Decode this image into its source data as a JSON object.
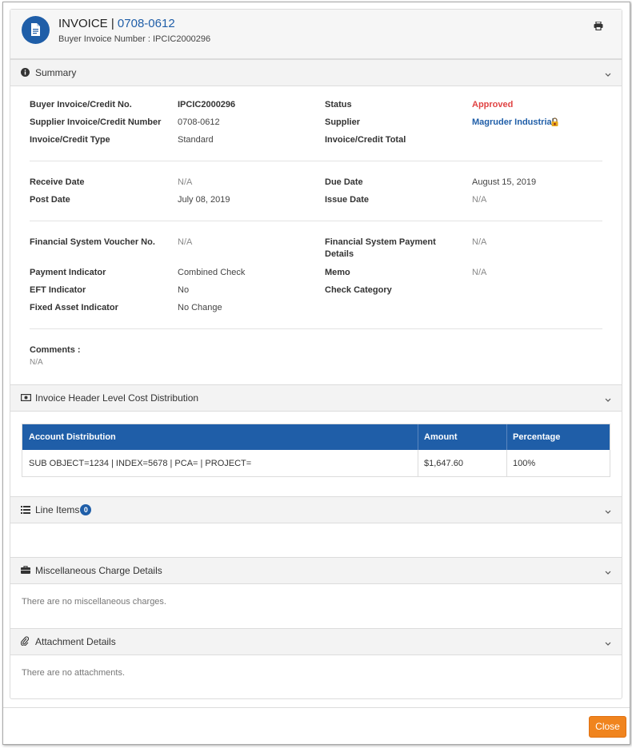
{
  "header": {
    "title_prefix": "INVOICE |",
    "invoice_number": "0708-0612",
    "buyer_invoice_label": "Buyer Invoice Number : IPCIC2000296"
  },
  "summary": {
    "title": "Summary",
    "fields": {
      "buyer_invoice_no_label": "Buyer Invoice/Credit No.",
      "buyer_invoice_no_value": "IPCIC2000296",
      "status_label": "Status",
      "status_value": "Approved",
      "supplier_invoice_no_label": "Supplier Invoice/Credit Number",
      "supplier_invoice_no_value": "0708-0612",
      "supplier_label": "Supplier",
      "supplier_value": "Magruder Industrial",
      "invoice_type_label": "Invoice/Credit Type",
      "invoice_type_value": "Standard",
      "invoice_total_label": "Invoice/Credit Total",
      "receive_date_label": "Receive Date",
      "receive_date_value": "N/A",
      "due_date_label": "Due Date",
      "due_date_value": "August 15, 2019",
      "post_date_label": "Post Date",
      "post_date_value": "July 08, 2019",
      "issue_date_label": "Issue Date",
      "issue_date_value": "N/A",
      "fs_voucher_label": "Financial System Voucher No.",
      "fs_voucher_value": "N/A",
      "fs_payment_label_1": "Financial System Payment",
      "fs_payment_label_2": "Details",
      "fs_payment_value": "N/A",
      "payment_indicator_label": "Payment Indicator",
      "payment_indicator_value": "Combined Check",
      "memo_label": "Memo",
      "memo_value": "N/A",
      "eft_indicator_label": "EFT Indicator",
      "eft_indicator_value": "No",
      "check_category_label": "Check Category",
      "fixed_asset_label": "Fixed Asset Indicator",
      "fixed_asset_value": "No Change",
      "comments_label": "Comments :",
      "comments_value": "N/A"
    }
  },
  "cost_distribution": {
    "title": "Invoice Header Level Cost Distribution",
    "columns": [
      "Account Distribution",
      "Amount",
      "Percentage"
    ],
    "rows": [
      {
        "account": "SUB OBJECT=1234 | INDEX=5678 | PCA= | PROJECT=",
        "amount": "$1,647.60",
        "percentage": "100%"
      }
    ]
  },
  "line_items": {
    "title": "Line Items",
    "count": "0"
  },
  "misc_charges": {
    "title": "Miscellaneous Charge Details",
    "empty_message": "There are no miscellaneous charges."
  },
  "attachments": {
    "title": "Attachment Details",
    "empty_message": "There are no attachments."
  },
  "footer": {
    "close_label": "Close"
  },
  "colors": {
    "primary": "#1f5ea8",
    "status_approved": "#e04343",
    "close_button": "#f0841e"
  },
  "icons": [
    "document-icon",
    "print-icon",
    "info-icon",
    "money-icon",
    "list-icon",
    "briefcase-icon",
    "paperclip-icon",
    "chevron-down-icon",
    "lock-icon"
  ]
}
